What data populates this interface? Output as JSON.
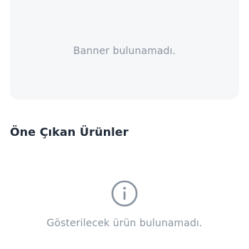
{
  "banner": {
    "empty_message": "Banner bulunamadı."
  },
  "featured_products": {
    "title": "Öne Çıkan Ürünler",
    "empty_icon": "info-icon",
    "empty_message": "Gösterilecek ürün bulunamadı."
  },
  "colors": {
    "placeholder_bg": "#f6f7f9",
    "muted_text": "#8a949e",
    "title_text": "#1f2a37"
  }
}
